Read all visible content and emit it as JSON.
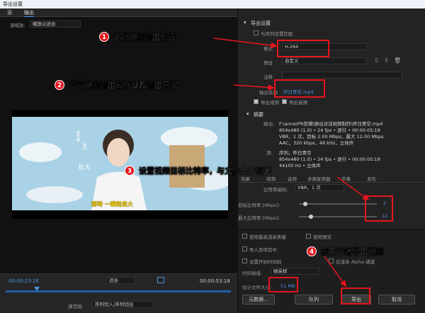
{
  "window": {
    "title": "导出设置"
  },
  "left": {
    "tabs": [
      "源",
      "输出"
    ],
    "source_scaling_label": "源缩放:",
    "source_scaling_value": "缩放以适合",
    "subtitle_1": "致青春",
    "subtitle_2": "一瞬间",
    "subtitle_3": "长大",
    "caption": "那時 一瞬間長大",
    "timecode_start": "00:00:23:18",
    "fit_label": "适合",
    "timecode_end": "00:00:53:18",
    "source_range_label": "源范围:",
    "source_range_value": "序列切入/序列切出"
  },
  "right": {
    "export_settings": "导出设置",
    "match_sequence": "与序列设置匹配",
    "format_label": "格式",
    "format_value": "H.264",
    "preset_label": "预设",
    "preset_value": "自定义",
    "comment_label": "注释",
    "output_name_label": "输出名称",
    "output_name_value": "昨日青空.mp4",
    "export_video": "导出视频",
    "export_audio": "导出音频",
    "summary": "摘要",
    "output_label": "输出:",
    "output_lines": [
      "F:\\anne\\PR剪辑\\弹出对话视频制作\\昨日青空.mp4",
      "854x480 (1.0) • 24 fps • 逐行 • 00:00:05:18",
      "VBR，1 次，目标 2.00 Mbps，最大 12.00 Mbps",
      "AAC，320 Kbps，48 kHz，立体声"
    ],
    "source_label": "源:",
    "source_lines": [
      "序列，昨日青空",
      "854x480 (1.0) • 24 fps • 逐行 • 00:00:05:18",
      "44100 Hz • 立体声"
    ],
    "tabs": [
      "效果",
      "视频",
      "音频",
      "多路复用器",
      "字幕",
      "发布"
    ],
    "bitrate_encoding_label": "比特率编码:",
    "bitrate_encoding_value": "VBR，1 次",
    "target_bitrate_label": "目标比特率 [Mbps]:",
    "target_bitrate_value": "2",
    "max_bitrate_label": "最大比特率 [Mbps]:",
    "max_bitrate_value": "12",
    "use_max_render_quality": "使用最高渲染质量",
    "use_previews": "使用预览",
    "import_to_project": "导入到项目中",
    "set_start_timecode": "设置开始时间码",
    "render_alpha_only": "仅渲染 Alpha 通道",
    "time_interpolation_label": "时间插值:",
    "time_interpolation_value": "帧采样",
    "est_file_size_label": "估计文件大小:",
    "est_file_size_value": "51 MB",
    "metadata_button": "元数据...",
    "queue_button": "队列",
    "export_button": "导出",
    "cancel_button": "取消"
  },
  "annotations": {
    "a1_num": "1",
    "a1_text": "选择视频输出格式",
    "a2_num": "2",
    "a2_text": "设置视频输出名称以及输出目录",
    "a3_num": "3",
    "a3_text": "设置视频目标比特率，与文件大小有关",
    "a4_num": "4",
    "a4_text": "点击开始导出视频"
  }
}
